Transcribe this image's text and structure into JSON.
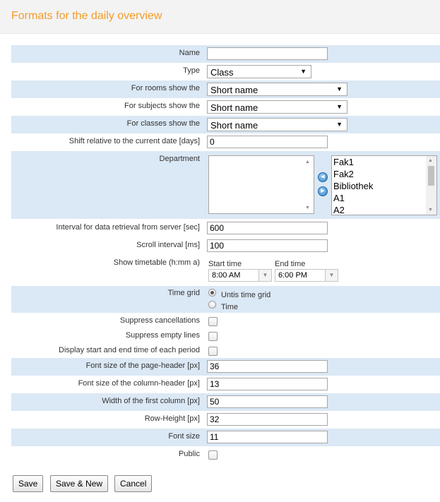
{
  "header": {
    "title": "Formats for the daily overview"
  },
  "form": {
    "name": {
      "label": "Name",
      "value": ""
    },
    "type": {
      "label": "Type",
      "value": "Class"
    },
    "rooms": {
      "label": "For rooms show the",
      "value": "Short name"
    },
    "subjects": {
      "label": "For subjects show the",
      "value": "Short name"
    },
    "classes": {
      "label": "For classes show the",
      "value": "Short name"
    },
    "shift": {
      "label": "Shift relative to the current date [days]",
      "value": "0"
    },
    "department": {
      "label": "Department",
      "selected": [],
      "available": [
        "Fak1",
        "Fak2",
        "Bibliothek",
        "A1",
        "A2"
      ]
    },
    "interval": {
      "label": "Interval for data retrieval from server [sec]",
      "value": "600"
    },
    "scroll": {
      "label": "Scroll interval [ms]",
      "value": "100"
    },
    "timetable": {
      "label": "Show timetable (h:mm a)",
      "start_label": "Start time",
      "start_value": "8:00 AM",
      "end_label": "End time",
      "end_value": "6:00 PM"
    },
    "timegrid": {
      "label": "Time grid",
      "option1": "Untis time grid",
      "option2": "Time",
      "selected": "Untis time grid"
    },
    "suppress_cancellations": {
      "label": "Suppress cancellations",
      "checked": false
    },
    "suppress_empty": {
      "label": "Suppress empty lines",
      "checked": false
    },
    "display_times": {
      "label": "Display start and end time of each period",
      "checked": false
    },
    "page_header_size": {
      "label": "Font size of the page-header [px]",
      "value": "36"
    },
    "column_header_size": {
      "label": "Font size of the column-header [px]",
      "value": "13"
    },
    "first_col_width": {
      "label": "Width of the first column [px]",
      "value": "50"
    },
    "row_height": {
      "label": "Row-Height [px]",
      "value": "32"
    },
    "font_size": {
      "label": "Font size",
      "value": "11"
    },
    "public": {
      "label": "Public",
      "checked": false
    }
  },
  "buttons": {
    "save": "Save",
    "save_new": "Save & New",
    "cancel": "Cancel"
  },
  "colors": {
    "title": "#f39c2c",
    "row_shade": "#dbe8f5",
    "move_button": "#2e7ec4"
  }
}
